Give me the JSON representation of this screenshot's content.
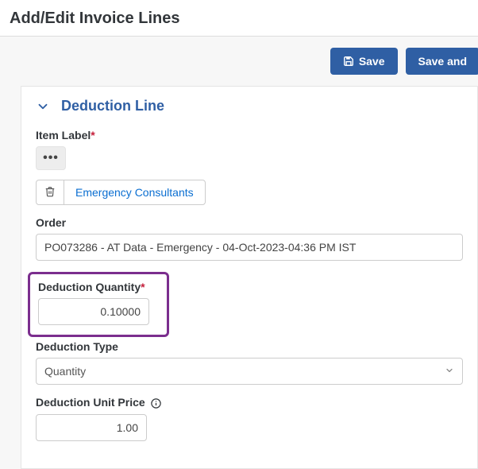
{
  "header": {
    "title": "Add/Edit Invoice Lines"
  },
  "actions": {
    "save_label": "Save",
    "save_and_label": "Save and"
  },
  "panel": {
    "title": "Deduction Line",
    "fields": {
      "item_label": {
        "label": "Item Label",
        "chip_text": "Emergency Consultants"
      },
      "order": {
        "label": "Order",
        "value": "PO073286 - AT Data - Emergency - 04-Oct-2023-04:36 PM IST"
      },
      "deduction_quantity": {
        "label": "Deduction Quantity",
        "value": "0.10000"
      },
      "deduction_type": {
        "label": "Deduction Type",
        "value": "Quantity"
      },
      "deduction_unit_price": {
        "label": "Deduction Unit Price",
        "value": "1.00"
      }
    }
  },
  "colors": {
    "primary": "#2f5fa4",
    "highlight": "#7b2e8e",
    "link": "#0a6ed1"
  }
}
